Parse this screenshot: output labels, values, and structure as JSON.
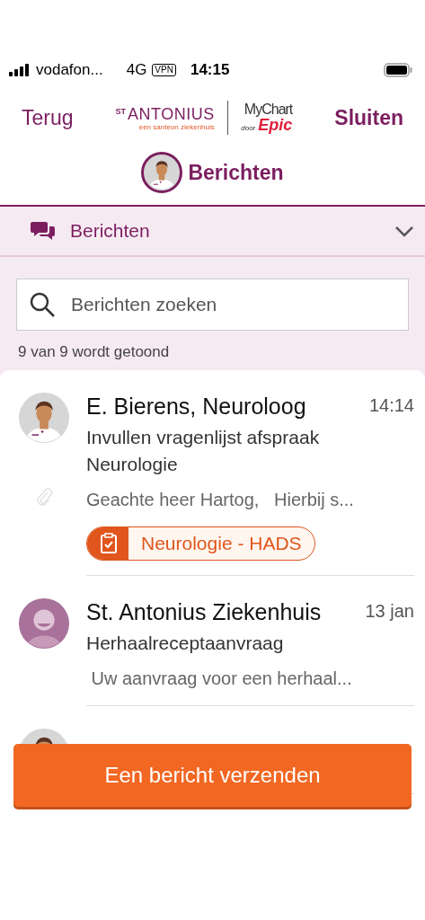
{
  "status_bar": {
    "carrier": "vodafon...",
    "network": "4G",
    "vpn": "VPN",
    "time": "14:15"
  },
  "header": {
    "back": "Terug",
    "close": "Sluiten",
    "logo": {
      "st": "ST",
      "name": "ANTONIUS",
      "tagline": "een santeon ziekenhuis"
    },
    "partner_logo": {
      "name": "MyChart",
      "by": "door",
      "brand": "Epic"
    }
  },
  "page_title": "Berichten",
  "section": {
    "label": "Berichten",
    "expanded": false
  },
  "search": {
    "placeholder": "Berichten zoeken"
  },
  "count": "9 van 9 wordt getoond",
  "messages": [
    {
      "kind": "doctor",
      "sender": "E. Bierens, Neuroloog",
      "time": "14:14",
      "subject": "Invullen vragenlijst afspraak Neurologie",
      "preview": "Geachte heer Hartog,   Hierbij s...",
      "attachment": true,
      "task": "Neurologie - HADS"
    },
    {
      "kind": "organization",
      "sender": "St. Antonius Ziekenhuis",
      "time": "13 jan",
      "subject": "Herhaalreceptaanvraag",
      "preview": " Uw aanvraag voor een herhaal...",
      "attachment": false
    },
    {
      "kind": "doctor"
    }
  ],
  "send_button": "Een bericht verzenden"
}
